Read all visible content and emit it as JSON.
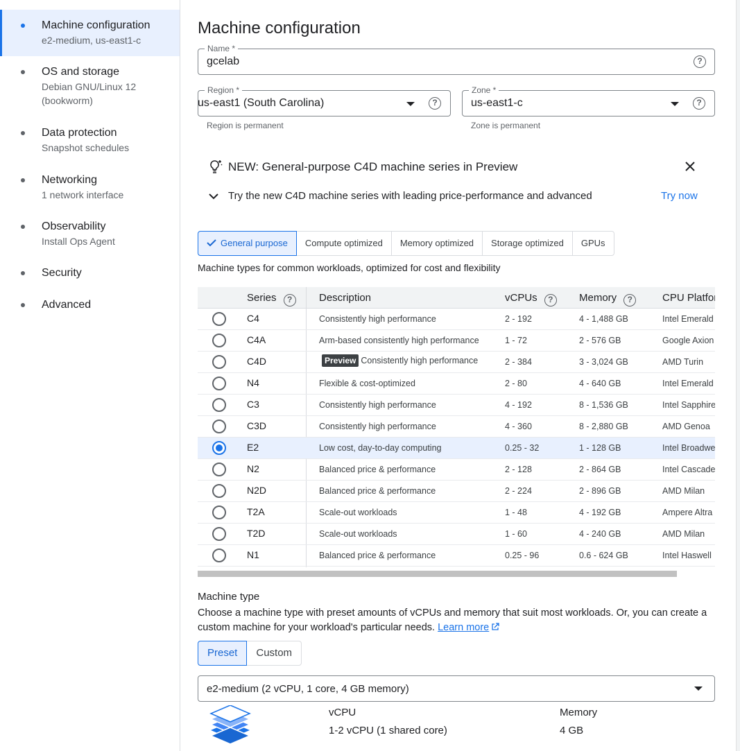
{
  "sidebar": {
    "items": [
      {
        "title": "Machine configuration",
        "sub": "e2-medium, us-east1-c",
        "active": true
      },
      {
        "title": "OS and storage",
        "sub": "Debian GNU/Linux 12",
        "sub2": "(bookworm)"
      },
      {
        "title": "Data protection",
        "sub": "Snapshot schedules"
      },
      {
        "title": "Networking",
        "sub": "1 network interface"
      },
      {
        "title": "Observability",
        "sub": "Install Ops Agent"
      },
      {
        "title": "Security"
      },
      {
        "title": "Advanced"
      }
    ]
  },
  "page_title": "Machine configuration",
  "name_field": {
    "label": "Name *",
    "value": "gcelab"
  },
  "region_field": {
    "label": "Region *",
    "value": "us-east1 (South Carolina)",
    "hint": "Region is permanent"
  },
  "zone_field": {
    "label": "Zone *",
    "value": "us-east1-c",
    "hint": "Zone is permanent"
  },
  "banner": {
    "title": "NEW: General-purpose C4D machine series in Preview",
    "text": "Try the new C4D machine series with leading price-performance and advanced",
    "action": "Try now"
  },
  "tabs": [
    "General purpose",
    "Compute optimized",
    "Memory optimized",
    "Storage optimized",
    "GPUs"
  ],
  "tabs_desc": "Machine types for common workloads, optimized for cost and flexibility",
  "table": {
    "headers": {
      "series": "Series",
      "description": "Description",
      "vcpus": "vCPUs",
      "memory": "Memory",
      "cpu": "CPU Platfor"
    },
    "preview_badge": "Preview",
    "rows": [
      {
        "series": "C4",
        "desc": "Consistently high performance",
        "vcpus": "2 - 192",
        "mem": "4 - 1,488 GB",
        "cpu": "Intel Emerald"
      },
      {
        "series": "C4A",
        "desc": "Arm-based consistently high performance",
        "vcpus": "1 - 72",
        "mem": "2 - 576 GB",
        "cpu": "Google Axion"
      },
      {
        "series": "C4D",
        "desc": "Consistently high performance",
        "vcpus": "2 - 384",
        "mem": "3 - 3,024 GB",
        "cpu": "AMD Turin"
      },
      {
        "series": "N4",
        "desc": "Flexible & cost-optimized",
        "vcpus": "2 - 80",
        "mem": "4 - 640 GB",
        "cpu": "Intel Emerald"
      },
      {
        "series": "C3",
        "desc": "Consistently high performance",
        "vcpus": "4 - 192",
        "mem": "8 - 1,536 GB",
        "cpu": "Intel Sapphire"
      },
      {
        "series": "C3D",
        "desc": "Consistently high performance",
        "vcpus": "4 - 360",
        "mem": "8 - 2,880 GB",
        "cpu": "AMD Genoa"
      },
      {
        "series": "E2",
        "desc": "Low cost, day-to-day computing",
        "vcpus": "0.25 - 32",
        "mem": "1 - 128 GB",
        "cpu": "Intel Broadwe"
      },
      {
        "series": "N2",
        "desc": "Balanced price & performance",
        "vcpus": "2 - 128",
        "mem": "2 - 864 GB",
        "cpu": "Intel Cascade"
      },
      {
        "series": "N2D",
        "desc": "Balanced price & performance",
        "vcpus": "2 - 224",
        "mem": "2 - 896 GB",
        "cpu": "AMD Milan"
      },
      {
        "series": "T2A",
        "desc": "Scale-out workloads",
        "vcpus": "1 - 48",
        "mem": "4 - 192 GB",
        "cpu": "Ampere Altra"
      },
      {
        "series": "T2D",
        "desc": "Scale-out workloads",
        "vcpus": "1 - 60",
        "mem": "4 - 240 GB",
        "cpu": "AMD Milan"
      },
      {
        "series": "N1",
        "desc": "Balanced price & performance",
        "vcpus": "0.25 - 96",
        "mem": "0.6 - 624 GB",
        "cpu": "Intel Haswell"
      }
    ]
  },
  "machine_type": {
    "label": "Machine type",
    "desc": "Choose a machine type with preset amounts of vCPUs and memory that suit most workloads. Or, you can create a custom machine for your workload's particular needs.",
    "learn_more": "Learn more",
    "toggle": [
      "Preset",
      "Custom"
    ],
    "selected": "e2-medium (2 vCPU, 1 core, 4 GB memory)",
    "vcpu_label": "vCPU",
    "vcpu_value": "1-2 vCPU (1 shared core)",
    "memory_label": "Memory",
    "memory_value": "4 GB"
  },
  "colors": {
    "accent": "#1a73e8",
    "selected_bg": "#e8f0fe"
  }
}
